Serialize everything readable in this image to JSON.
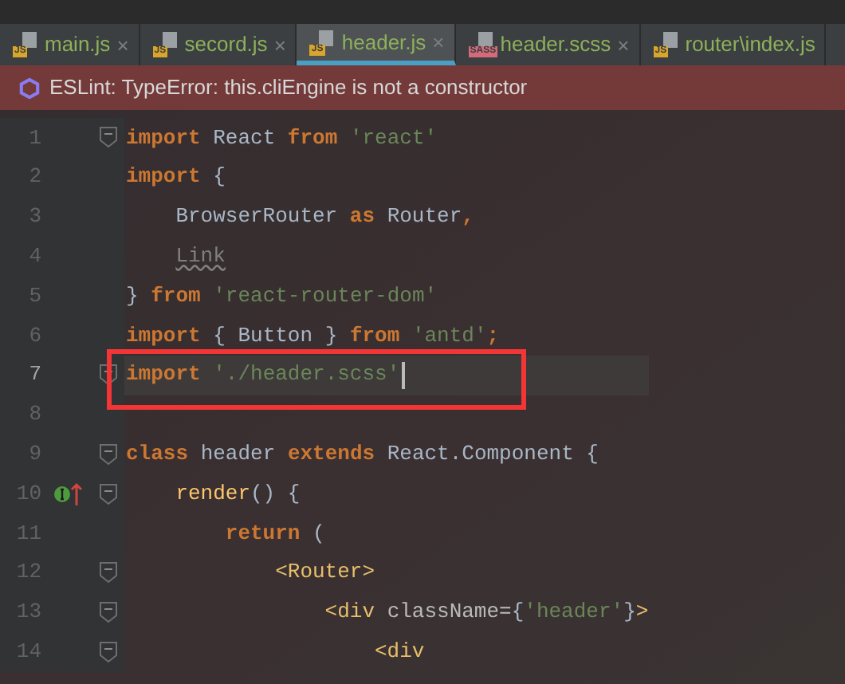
{
  "tabs": [
    {
      "label": "main.js",
      "badge": "JS",
      "kind": "js",
      "close": "×",
      "selected": false
    },
    {
      "label": "secord.js",
      "badge": "JS",
      "kind": "js",
      "close": "×",
      "selected": false
    },
    {
      "label": "header.js",
      "badge": "JS",
      "kind": "js",
      "close": "×",
      "selected": true
    },
    {
      "label": "header.scss",
      "badge": "SASS",
      "kind": "sass",
      "close": "×",
      "selected": false
    },
    {
      "label": "router\\index.js",
      "badge": "JS",
      "kind": "js",
      "selected": false
    }
  ],
  "banner": {
    "message": "ESLint: TypeError: this.cliEngine is not a constructor"
  },
  "editor": {
    "lines": [
      {
        "number": "1",
        "fold": true,
        "current": false,
        "tokens": [
          {
            "kind": "kw",
            "text": "import"
          },
          {
            "kind": "plain",
            "text": " React "
          },
          {
            "kind": "kw",
            "text": "from"
          },
          {
            "kind": "str",
            "text": " 'react'"
          }
        ]
      },
      {
        "number": "2",
        "fold": false,
        "current": false,
        "tokens": [
          {
            "kind": "kw",
            "text": "import"
          },
          {
            "kind": "plain",
            "text": " {"
          }
        ],
        "children": [
          {
            "number": "3",
            "fold": false,
            "current": false,
            "tokens": [
              {
                "kind": "plain",
                "text": "BrowserRouter "
              },
              {
                "kind": "kw",
                "text": "as"
              },
              {
                "kind": "plain",
                "text": " Router"
              },
              {
                "kind": "kw",
                "text": ","
              }
            ]
          },
          {
            "number": "4",
            "fold": false,
            "current": false,
            "tokens": [
              {
                "kind": "unused",
                "text": "Link"
              }
            ]
          }
        ]
      },
      {
        "number": "5",
        "fold": false,
        "current": false,
        "tokens": [
          {
            "kind": "plain",
            "text": "} "
          },
          {
            "kind": "kw",
            "text": "from"
          },
          {
            "kind": "str",
            "text": " 'react-router-dom'"
          }
        ]
      },
      {
        "number": "6",
        "fold": false,
        "current": false,
        "tokens": [
          {
            "kind": "kw",
            "text": "import"
          },
          {
            "kind": "plain",
            "text": " { Button } "
          },
          {
            "kind": "kw",
            "text": "from"
          },
          {
            "kind": "str",
            "text": " 'antd'"
          },
          {
            "kind": "kw",
            "text": ";"
          }
        ]
      },
      {
        "number": "7",
        "fold": true,
        "current": true,
        "tokens": [
          {
            "kind": "kw",
            "text": "import"
          },
          {
            "kind": "str",
            "text": " './header.scss'"
          }
        ]
      },
      {
        "number": "8",
        "fold": false,
        "current": false
      },
      {
        "number": "9",
        "fold": true,
        "current": false,
        "tokens": [
          {
            "kind": "kw",
            "text": "class"
          },
          {
            "kind": "plain",
            "text": " header "
          },
          {
            "kind": "kw",
            "text": "extends"
          },
          {
            "kind": "plain",
            "text": " React.Component {"
          }
        ],
        "children": [
          {
            "number": "10",
            "fold": true,
            "current": false,
            "marker": true,
            "tokens": [
              {
                "kind": "fn",
                "text": "render"
              },
              {
                "kind": "plain",
                "text": "() {"
              }
            ],
            "children": [
              {
                "number": "11",
                "fold": false,
                "current": false,
                "tokens": [
                  {
                    "kind": "kw",
                    "text": "return"
                  },
                  {
                    "kind": "plain",
                    "text": " ("
                  }
                ],
                "children": [
                  {
                    "number": "12",
                    "fold": true,
                    "current": false,
                    "tokens": [
                      {
                        "kind": "tag",
                        "text": "<Router>"
                      }
                    ],
                    "children": [
                      {
                        "number": "13",
                        "fold": true,
                        "current": false,
                        "tokens": [
                          {
                            "kind": "tag",
                            "text": "<div"
                          },
                          {
                            "kind": "attr",
                            "text": " className="
                          },
                          {
                            "kind": "plain",
                            "text": "{"
                          },
                          {
                            "kind": "str",
                            "text": "'header'"
                          },
                          {
                            "kind": "plain",
                            "text": "}"
                          },
                          {
                            "kind": "tag",
                            "text": ">"
                          }
                        ],
                        "children": [
                          {
                            "number": "14",
                            "fold": true,
                            "current": false,
                            "tokens": [
                              {
                                "kind": "tag",
                                "text": "<div"
                              }
                            ]
                          }
                        ]
                      }
                    ]
                  }
                ]
              }
            ]
          }
        ]
      }
    ]
  }
}
